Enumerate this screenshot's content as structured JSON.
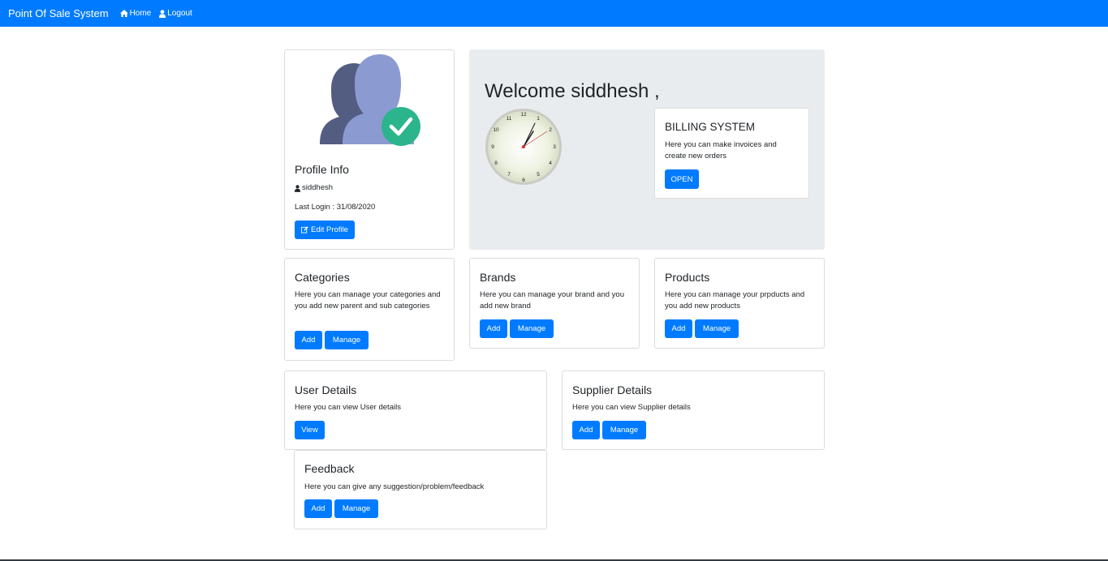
{
  "navbar": {
    "brand": "Point Of Sale System",
    "home_label": "Home",
    "logout_label": "Logout"
  },
  "profile": {
    "title": "Profile Info",
    "username": "siddhesh",
    "last_login": "Last Login : 31/08/2020",
    "edit_label": "Edit Profile"
  },
  "welcome": {
    "text": "Welcome siddhesh ,",
    "clock_numbers": [
      "12",
      "1",
      "2",
      "3",
      "4",
      "5",
      "6",
      "7",
      "8",
      "9",
      "10",
      "11"
    ]
  },
  "billing": {
    "title": "BILLING SYSTEM",
    "text": "Here you can make invoices and create new orders",
    "button": "OPEN"
  },
  "categories": {
    "title": "Categories",
    "text": "Here you can manage your categories and you add new parent and sub categories",
    "add": "Add",
    "manage": "Manage"
  },
  "brands": {
    "title": "Brands",
    "text": "Here you can manage your brand and you add new brand",
    "add": "Add",
    "manage": "Manage"
  },
  "products": {
    "title": "Products",
    "text": "Here you can manage your prpducts and you add new products",
    "add": "Add",
    "manage": "Manage"
  },
  "user_details": {
    "title": "User Details",
    "text": "Here you can view User details",
    "view": "View"
  },
  "supplier_details": {
    "title": "Supplier Details",
    "text": "Here you can view Supplier details",
    "add": "Add",
    "manage": "Manage"
  },
  "feedback": {
    "title": "Feedback",
    "text": "Here you can give any suggestion/problem/feedback",
    "add": "Add",
    "manage": "Manage"
  },
  "colors": {
    "primary": "#007bff",
    "jumbotron": "#e9ecef",
    "avatar_dark": "#535d82",
    "avatar_light": "#8b9bd1",
    "check_green": "#2cb58c"
  }
}
